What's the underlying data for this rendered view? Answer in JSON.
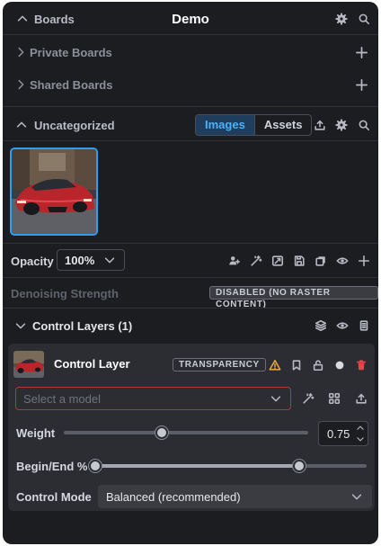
{
  "boards": {
    "section_label": "Boards",
    "title": "Demo",
    "private_label": "Private Boards",
    "shared_label": "Shared Boards",
    "uncategorized_label": "Uncategorized",
    "tabs": {
      "images": "Images",
      "assets": "Assets",
      "active": "Images"
    }
  },
  "params": {
    "opacity_label": "Opacity",
    "opacity_value": "100%",
    "denoise_label": "Denoising Strength",
    "denoise_badge": "DISABLED (NO RASTER CONTENT)"
  },
  "control_layers": {
    "header_label": "Control Layers (1)",
    "layer": {
      "name": "Control Layer",
      "badge": "TRANSPARENCY",
      "model_placeholder": "Select a model",
      "weight_label": "Weight",
      "weight_value": "0.75",
      "weight_level": 0.5,
      "begin_end_label": "Begin/End %",
      "begin_value": 0.0,
      "end_value": 0.75,
      "control_mode_label": "Control Mode",
      "control_mode_value": "Balanced (recommended)"
    }
  },
  "colors": {
    "accent": "#2d9ef0",
    "danger": "#e04848",
    "warning": "#e3a13a",
    "bg": "#1c1d21"
  }
}
